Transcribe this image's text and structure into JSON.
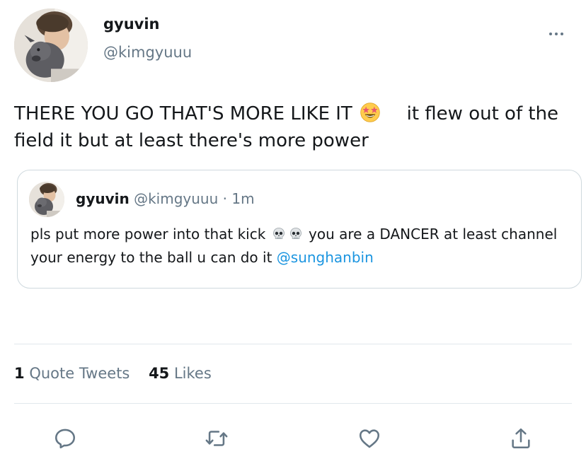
{
  "tweet": {
    "author": {
      "display_name": "gyuvin",
      "handle": "@kimgyuuu"
    },
    "text_part1": "THERE YOU GO THAT'S MORE LIKE IT",
    "emoji": "star-struck-emoji",
    "text_part2": "it flew out of the field it but at least there's more power"
  },
  "quote": {
    "author": {
      "display_name": "gyuvin",
      "handle": "@kimgyuuu",
      "separator": "·",
      "time": "1m"
    },
    "text_part1": "pls put more power into that kick",
    "emoji": "skull-emoji",
    "text_part2": "you are a DANCER at least channel your energy to the ball u can do it",
    "mention": "@sunghanbin"
  },
  "stats": {
    "quote_tweets_count": "1",
    "quote_tweets_label": "Quote Tweets",
    "likes_count": "45",
    "likes_label": "Likes"
  },
  "actions": [
    "reply-icon",
    "retweet-icon",
    "like-icon",
    "share-icon"
  ],
  "colors": {
    "text": "#14171a",
    "secondary": "#657786",
    "link": "#1b95e0",
    "border": "#cfd9de"
  }
}
